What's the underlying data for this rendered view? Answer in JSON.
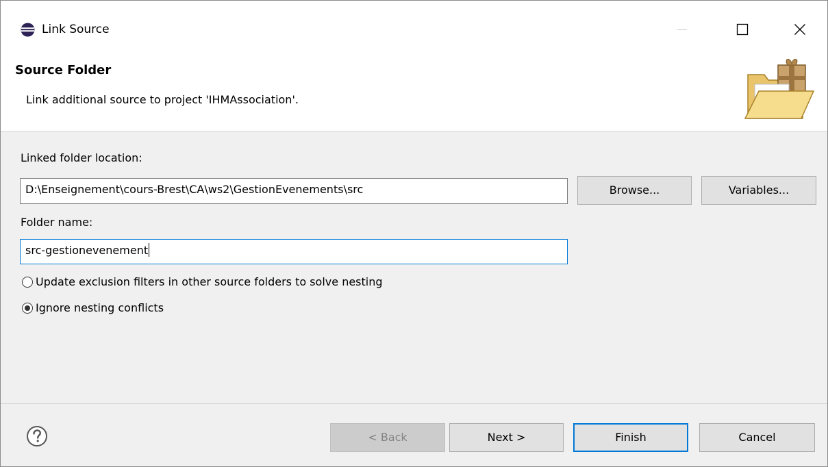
{
  "window": {
    "title": "Link Source",
    "app_icon": "eclipse-icon",
    "controls": {
      "minimize_icon": "minimize-icon",
      "maximize_icon": "maximize-icon",
      "close_icon": "close-icon"
    }
  },
  "banner": {
    "title": "Source Folder",
    "description": "Link additional source to project 'IHMAssociation'.",
    "image": "folder-with-package-icon"
  },
  "form": {
    "location_label": "Linked folder location:",
    "location_value": "D:\\Enseignement\\cours-Brest\\CA\\ws2\\GestionEvenements\\src",
    "browse_label": "Browse...",
    "variables_label": "Variables...",
    "folder_name_label": "Folder name:",
    "folder_name_value": "src-gestionevenement",
    "options": [
      {
        "label": "Update exclusion filters in other source folders to solve nesting",
        "checked": false
      },
      {
        "label": "Ignore nesting conflicts",
        "checked": true
      }
    ]
  },
  "footer": {
    "help_icon": "help-icon",
    "back_label": "< Back",
    "next_label": "Next >",
    "finish_label": "Finish",
    "cancel_label": "Cancel"
  },
  "colors": {
    "focus_accent": "#0078d7",
    "dialog_background": "#f0f0f0"
  }
}
